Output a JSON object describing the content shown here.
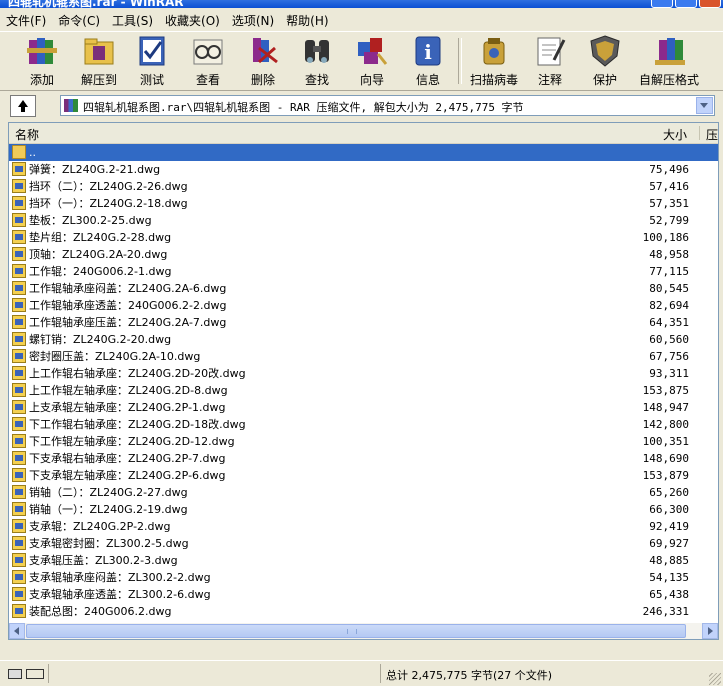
{
  "window": {
    "title": "四辊轧机辊系图.rar - WinRAR"
  },
  "menu": [
    {
      "label": "文件(F)"
    },
    {
      "label": "命令(C)"
    },
    {
      "label": "工具(S)"
    },
    {
      "label": "收藏夹(O)"
    },
    {
      "label": "选项(N)"
    },
    {
      "label": "帮助(H)"
    }
  ],
  "toolbar": [
    {
      "label": "添加",
      "icon": "add-books-icon"
    },
    {
      "label": "解压到",
      "icon": "extract-folder-icon"
    },
    {
      "label": "测试",
      "icon": "test-check-icon"
    },
    {
      "label": "查看",
      "icon": "view-glasses-icon"
    },
    {
      "label": "删除",
      "icon": "delete-icon"
    },
    {
      "label": "查找",
      "icon": "find-binoculars-icon"
    },
    {
      "label": "向导",
      "icon": "wizard-icon"
    },
    {
      "label": "信息",
      "icon": "info-icon"
    },
    {
      "label": "扫描病毒",
      "icon": "scan-virus-icon"
    },
    {
      "label": "注释",
      "icon": "comment-icon"
    },
    {
      "label": "保护",
      "icon": "protect-shield-icon"
    },
    {
      "label": "自解压格式",
      "icon": "sfx-icon"
    }
  ],
  "address": {
    "text": "四辊轧机辊系图.rar\\四辊轧机辊系图 - RAR 压缩文件, 解包大小为 2,475,775 字节"
  },
  "columns": {
    "name": "名称",
    "size": "大小",
    "packed": "压"
  },
  "files": [
    {
      "name": "..",
      "size": "",
      "type": "folder",
      "selected": true
    },
    {
      "name": "弹簧：ZL240G.2-21.dwg",
      "size": "75,496"
    },
    {
      "name": "挡环（二）：ZL240G.2-26.dwg",
      "size": "57,416"
    },
    {
      "name": "挡环（一）：ZL240G.2-18.dwg",
      "size": "57,351"
    },
    {
      "name": "垫板：ZL300.2-25.dwg",
      "size": "52,799"
    },
    {
      "name": "垫片组：ZL240G.2-28.dwg",
      "size": "100,186"
    },
    {
      "name": "顶轴：ZL240G.2A-20.dwg",
      "size": "48,958"
    },
    {
      "name": "工作辊：240G006.2-1.dwg",
      "size": "77,115"
    },
    {
      "name": "工作辊轴承座闷盖：ZL240G.2A-6.dwg",
      "size": "80,545"
    },
    {
      "name": "工作辊轴承座透盖：240G006.2-2.dwg",
      "size": "82,694"
    },
    {
      "name": "工作辊轴承座压盖：ZL240G.2A-7.dwg",
      "size": "64,351"
    },
    {
      "name": "螺钉销：ZL240G.2-20.dwg",
      "size": "60,560"
    },
    {
      "name": "密封圈压盖：ZL240G.2A-10.dwg",
      "size": "67,756"
    },
    {
      "name": "上工作辊右轴承座：ZL240G.2D-20改.dwg",
      "size": "93,311"
    },
    {
      "name": "上工作辊左轴承座：ZL240G.2D-8.dwg",
      "size": "153,875"
    },
    {
      "name": "上支承辊左轴承座：ZL240G.2P-1.dwg",
      "size": "148,947"
    },
    {
      "name": "下工作辊右轴承座：ZL240G.2D-18改.dwg",
      "size": "142,800"
    },
    {
      "name": "下工作辊左轴承座：ZL240G.2D-12.dwg",
      "size": "100,351"
    },
    {
      "name": "下支承辊右轴承座：ZL240G.2P-7.dwg",
      "size": "148,690"
    },
    {
      "name": "下支承辊左轴承座：ZL240G.2P-6.dwg",
      "size": "153,879"
    },
    {
      "name": "销轴（二）：ZL240G.2-27.dwg",
      "size": "65,260"
    },
    {
      "name": "销轴（一）：ZL240G.2-19.dwg",
      "size": "66,300"
    },
    {
      "name": "支承辊：ZL240G.2P-2.dwg",
      "size": "92,419"
    },
    {
      "name": "支承辊密封圈：ZL300.2-5.dwg",
      "size": "69,927"
    },
    {
      "name": "支承辊压盖：ZL300.2-3.dwg",
      "size": "48,885"
    },
    {
      "name": "支承辊轴承座闷盖：ZL300.2-2.dwg",
      "size": "54,135"
    },
    {
      "name": "支承辊轴承座透盖：ZL300.2-6.dwg",
      "size": "65,438"
    },
    {
      "name": "装配总图：240G006.2.dwg",
      "size": "246,331"
    }
  ],
  "status": {
    "summary": "总计 2,475,775 字节(27 个文件)"
  },
  "colors": {
    "selection": "#316ac5",
    "window_bg": "#ece9d8",
    "titlebar": "#0b4fd3"
  }
}
